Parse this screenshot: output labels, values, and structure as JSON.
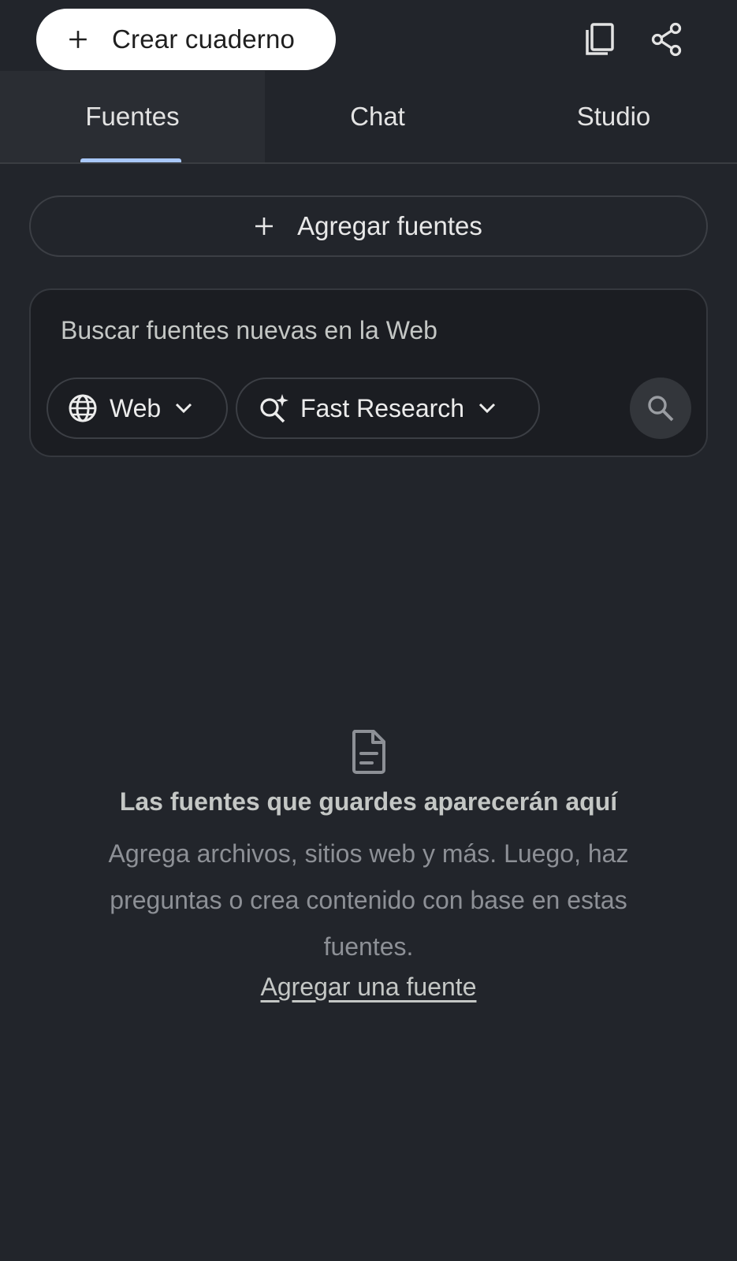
{
  "header": {
    "create_label": "Crear cuaderno",
    "icons": [
      "plus-icon",
      "copy-icon",
      "share-icon"
    ]
  },
  "tabs": [
    {
      "label": "Fuentes",
      "active": true
    },
    {
      "label": "Chat",
      "active": false
    },
    {
      "label": "Studio",
      "active": false
    }
  ],
  "sources": {
    "add_label": "Agregar fuentes"
  },
  "search": {
    "placeholder": "Buscar fuentes nuevas en la Web",
    "value": "",
    "source_chip": "Web",
    "mode_chip": "Fast Research"
  },
  "empty_state": {
    "title": "Las fuentes que guardes aparecerán aquí",
    "description": "Agrega archivos, sitios web y más. Luego, haz preguntas o crea contenido con base en estas fuentes.",
    "link": "Agregar una fuente"
  },
  "colors": {
    "background": "#22252b",
    "card": "#1b1d22",
    "accent": "#a8c7fa"
  }
}
